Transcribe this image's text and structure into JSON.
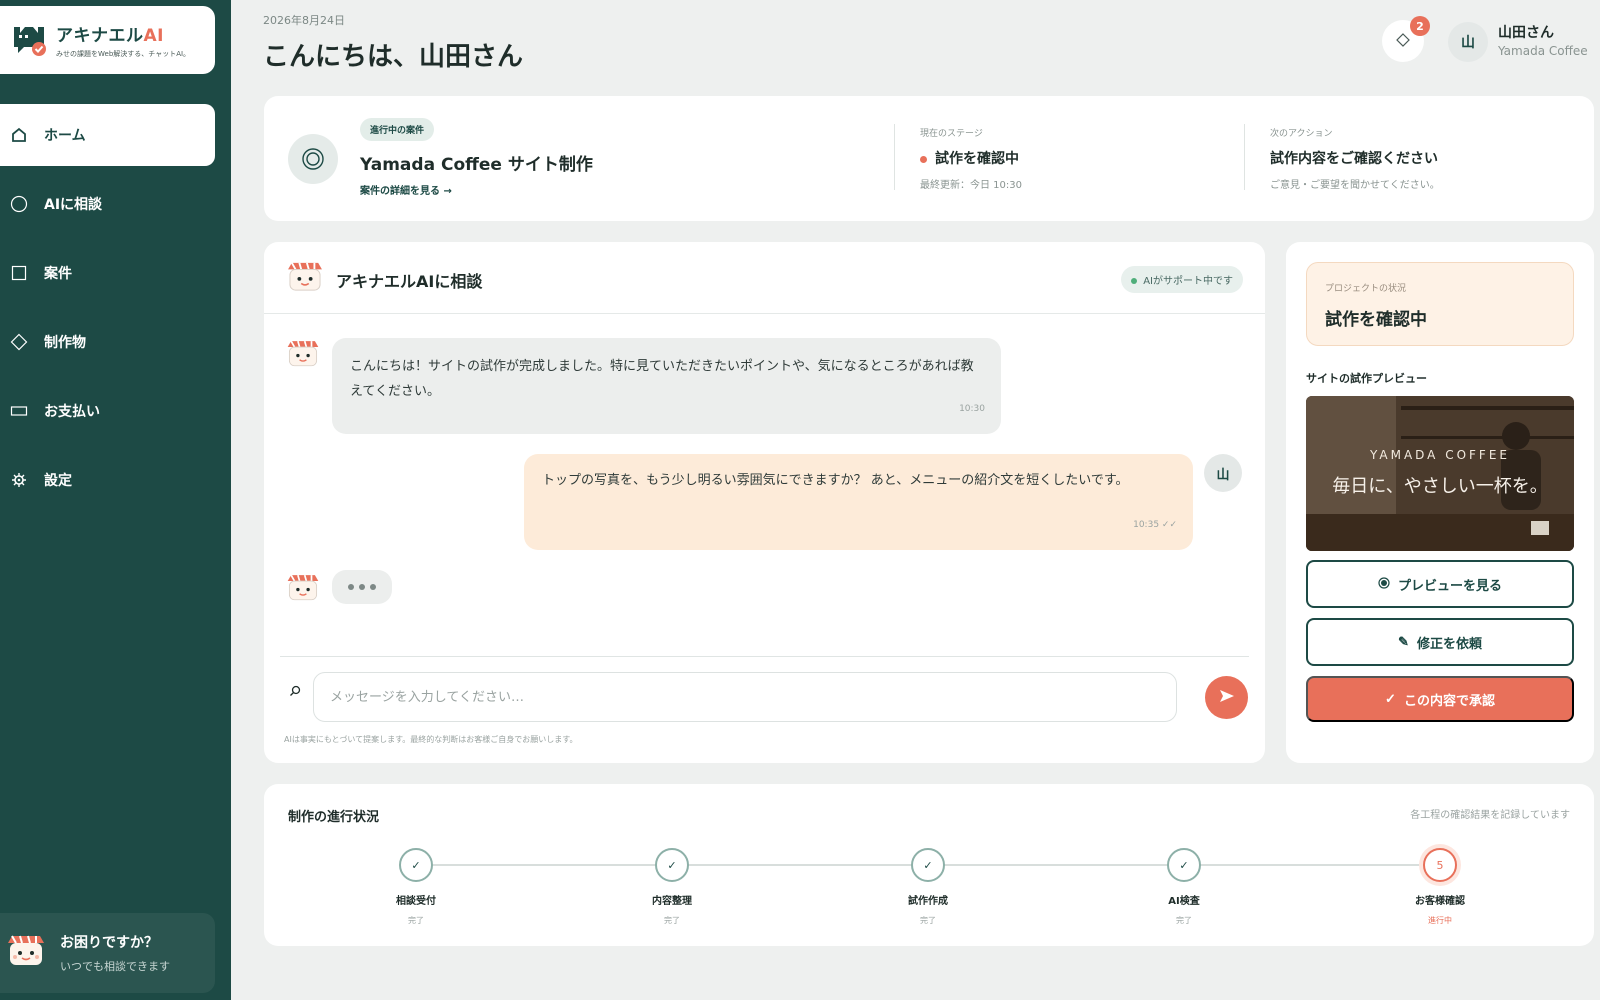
{
  "brand": {
    "name": "アキナエル",
    "name_ai": "AI",
    "tagline": "みせの課題をWeb解決する、チャットAI。"
  },
  "nav": {
    "items": [
      {
        "label": "ホーム",
        "icon": "home-icon"
      },
      {
        "label": "AIに相談",
        "icon": "chat-circle-icon"
      },
      {
        "label": "案件",
        "icon": "square-icon"
      },
      {
        "label": "制作物",
        "icon": "diamond-icon"
      },
      {
        "label": "お支払い",
        "icon": "card-icon"
      },
      {
        "label": "設定",
        "icon": "gear-icon"
      }
    ]
  },
  "help": {
    "title": "お困りですか？",
    "sub": "いつでも相談できます"
  },
  "header": {
    "date": "2026年8月24日",
    "greeting": "こんにちは、山田さん",
    "notification_count": "2",
    "avatar_char": "山",
    "user_name": "山田さん",
    "user_company": "Yamada Coffee"
  },
  "project": {
    "badge": "進行中の案件",
    "name": "Yamada Coffee サイト制作",
    "link": "案件の詳細を見る →",
    "stage_label": "現在のステージ",
    "stage_value": "試作を確認中",
    "stage_updated": "最終更新：今日 10:30",
    "next_label": "次のアクション",
    "next_value": "試作内容をご確認ください",
    "next_sub": "ご意見・ご要望を聞かせてください。"
  },
  "chat": {
    "title": "アキナエルAIに相談",
    "status": "AIがサポート中です",
    "messages": [
      {
        "from": "ai",
        "text": "こんにちは！サイトの試作が完成しました。特に見ていただきたいポイントや、気になるところがあれば教えてください。",
        "time": "10:30"
      },
      {
        "from": "user",
        "text": "トップの写真を、もう少し明るい雰囲気にできますか？ あと、メニューの紹介文を短くしたいです。",
        "time": "10:35 ✓✓"
      }
    ],
    "input_placeholder": "メッセージを入力してください…",
    "disclaimer": "AIは事実にもとづいて提案します。最終的な判断はお客様ご自身でお願いします。"
  },
  "side": {
    "status_label": "プロジェクトの状況",
    "status_value": "試作を確認中",
    "preview_title": "サイトの試作プレビュー",
    "preview_brand": "YAMADA COFFEE",
    "preview_tagline": "毎日に、やさしい一杯を。",
    "btn_preview": "プレビューを見る",
    "btn_revise": "修正を依頼",
    "btn_approve": "この内容で承認"
  },
  "progress": {
    "title": "制作の進行状況",
    "note": "各工程の確認結果を記録しています",
    "steps": [
      {
        "mark": "✓",
        "name": "相談受付",
        "status": "完了"
      },
      {
        "mark": "✓",
        "name": "内容整理",
        "status": "完了"
      },
      {
        "mark": "✓",
        "name": "試作作成",
        "status": "完了"
      },
      {
        "mark": "✓",
        "name": "AI検査",
        "status": "完了"
      },
      {
        "mark": "5",
        "name": "お客様確認",
        "status": "進行中"
      }
    ]
  },
  "colors": {
    "sidebar": "#1d4a45",
    "accent": "#e8705a",
    "background": "#eef0ef"
  }
}
